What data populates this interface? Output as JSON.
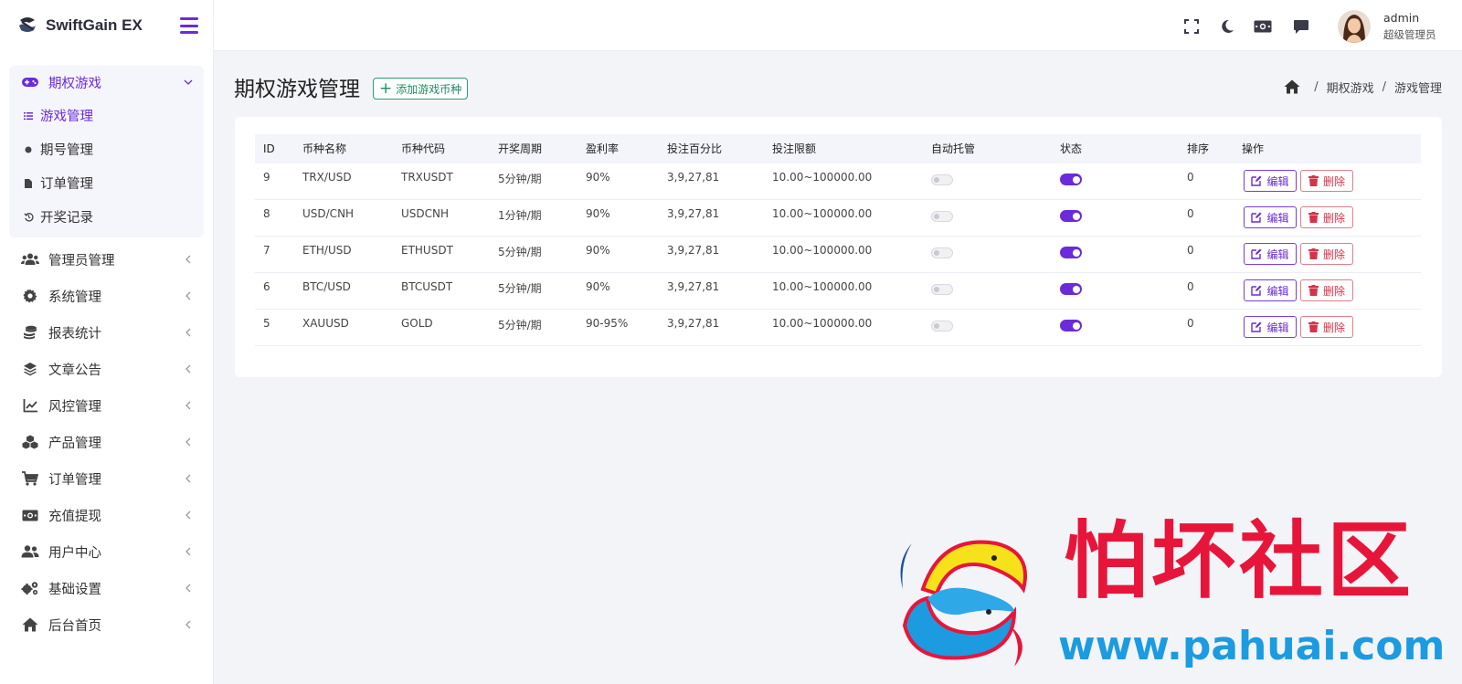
{
  "app": {
    "name": "SwiftGain EX"
  },
  "sidebar": {
    "open_group": {
      "label": "期权游戏",
      "icon": "gamepad-icon",
      "subitems": [
        {
          "label": "游戏管理",
          "icon": "list-icon",
          "active": true
        },
        {
          "label": "期号管理",
          "icon": "dot-icon"
        },
        {
          "label": "订单管理",
          "icon": "file-icon"
        },
        {
          "label": "开奖记录",
          "icon": "history-icon"
        }
      ]
    },
    "items": [
      {
        "label": "管理员管理",
        "icon": "users-icon"
      },
      {
        "label": "系统管理",
        "icon": "gear-icon"
      },
      {
        "label": "报表统计",
        "icon": "coins-icon"
      },
      {
        "label": "文章公告",
        "icon": "layers-icon"
      },
      {
        "label": "风控管理",
        "icon": "chart-line-icon"
      },
      {
        "label": "产品管理",
        "icon": "cubes-icon"
      },
      {
        "label": "订单管理",
        "icon": "cart-icon"
      },
      {
        "label": "充值提现",
        "icon": "money-icon"
      },
      {
        "label": "用户中心",
        "icon": "user-group-icon"
      },
      {
        "label": "基础设置",
        "icon": "cogs-icon"
      },
      {
        "label": "后台首页",
        "icon": "home-icon"
      }
    ]
  },
  "topbar": {
    "icons": [
      "fullscreen-icon",
      "moon-icon",
      "money-icon",
      "chat-icon"
    ],
    "user": {
      "name": "admin",
      "role": "超级管理员"
    }
  },
  "page": {
    "title": "期权游戏管理",
    "add_button": "添加游戏币种",
    "breadcrumb": [
      "期权游戏",
      "游戏管理"
    ]
  },
  "table": {
    "columns": [
      "ID",
      "币种名称",
      "币种代码",
      "开奖周期",
      "盈利率",
      "投注百分比",
      "投注限额",
      "自动托管",
      "状态",
      "排序",
      "操作"
    ],
    "rows": [
      {
        "id": "9",
        "name": "TRX/USD",
        "code": "TRXUSDT",
        "period": "5分钟/期",
        "rate": "90%",
        "percent": "3,9,27,81",
        "limit": "10.00~100000.00",
        "auto": false,
        "status": true,
        "sort": "0"
      },
      {
        "id": "8",
        "name": "USD/CNH",
        "code": "USDCNH",
        "period": "1分钟/期",
        "rate": "90%",
        "percent": "3,9,27,81",
        "limit": "10.00~100000.00",
        "auto": false,
        "status": true,
        "sort": "0"
      },
      {
        "id": "7",
        "name": "ETH/USD",
        "code": "ETHUSDT",
        "period": "5分钟/期",
        "rate": "90%",
        "percent": "3,9,27,81",
        "limit": "10.00~100000.00",
        "auto": false,
        "status": true,
        "sort": "0"
      },
      {
        "id": "6",
        "name": "BTC/USD",
        "code": "BTCUSDT",
        "period": "5分钟/期",
        "rate": "90%",
        "percent": "3,9,27,81",
        "limit": "10.00~100000.00",
        "auto": false,
        "status": true,
        "sort": "0"
      },
      {
        "id": "5",
        "name": "XAUUSD",
        "code": "GOLD",
        "period": "5分钟/期",
        "rate": "90-95%",
        "percent": "3,9,27,81",
        "limit": "10.00~100000.00",
        "auto": false,
        "status": true,
        "sort": "0"
      }
    ],
    "edit_label": "编辑",
    "delete_label": "删除"
  },
  "watermark": {
    "title": "怕坏社区",
    "url": "www.pahuai.com"
  },
  "colors": {
    "accent": "#6b2bd9",
    "danger": "#d6334a",
    "success": "#1f8a5f"
  }
}
